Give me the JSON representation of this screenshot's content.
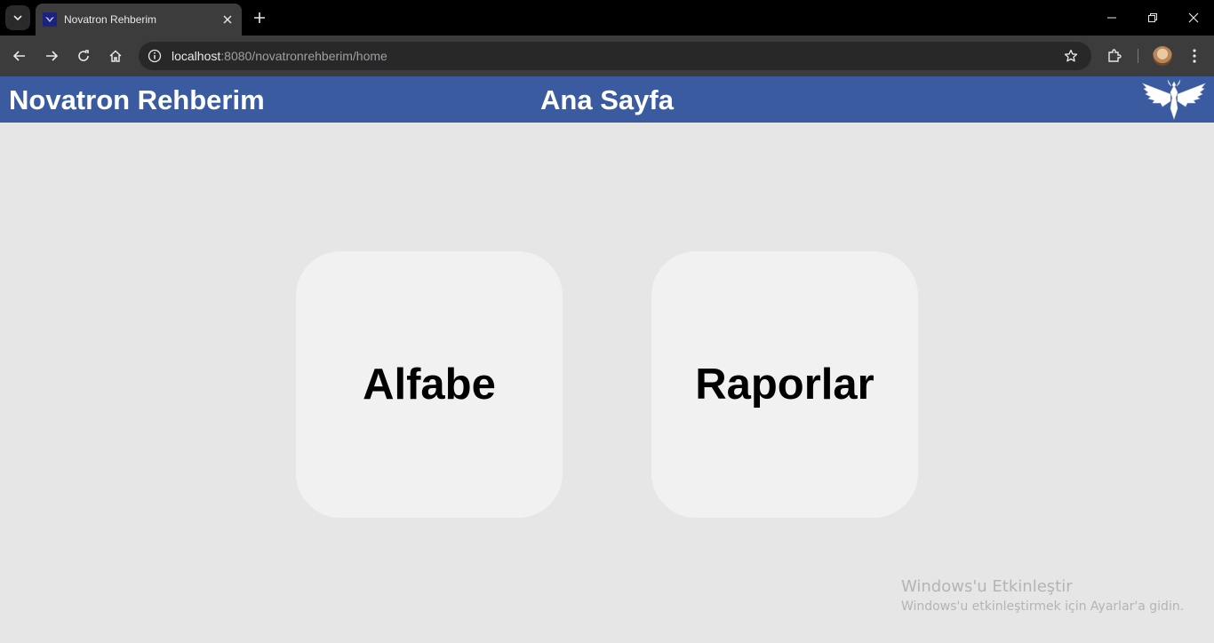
{
  "browser": {
    "tab_title": "Novatron Rehberim",
    "url_host": "localhost",
    "url_path": ":8080/novatronrehberim/home"
  },
  "header": {
    "app_title": "Novatron Rehberim",
    "page_title": "Ana Sayfa",
    "logo_icon": "eagle-logo-icon",
    "background_color": "#3a5ba0"
  },
  "cards": [
    {
      "label": "Alfabe"
    },
    {
      "label": "Raporlar"
    }
  ],
  "watermark": {
    "title": "Windows'u Etkinleştir",
    "subtitle": "Windows'u etkinleştirmek için Ayarlar'a gidin."
  }
}
